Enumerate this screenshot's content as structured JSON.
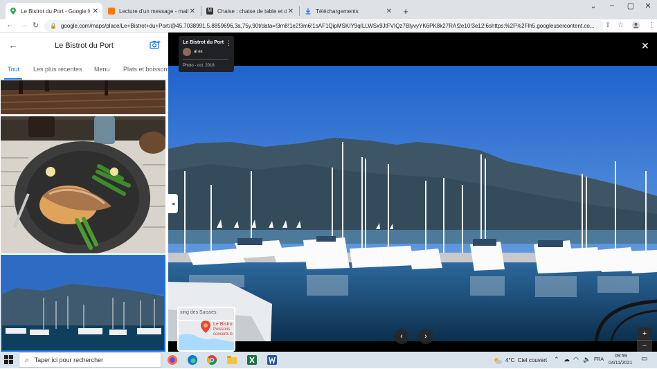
{
  "browser": {
    "tabs": [
      {
        "label": "Le Bistrot du Port - Google Maps",
        "active": true,
        "icon": "maps-pin-icon"
      },
      {
        "label": "Lecture d'un message - mail Orange",
        "active": false,
        "icon": "orange-mail-icon"
      },
      {
        "label": "Chaise : chaise de table et de salle",
        "active": false,
        "icon": "m-site-icon"
      },
      {
        "label": "Téléchargements",
        "active": false,
        "icon": "download-icon"
      }
    ],
    "new_tab": "+",
    "url": "google.com/maps/place/Le+Bistrot+du+Port/@45.7038991,5.8859696,3a,75y,90t/data=!3m8!1e2!3m6!1sAF1QipMSKIY9qILLWSx9JtFVIQz7BlyvyYK6PK8k27RA!2e10!3e12!6shttps:%2F%2Flh5.googleusercontent.co..."
  },
  "left_panel": {
    "title": "Le Bistrot du Port",
    "tabs": [
      "Tout",
      "Les plus récentes",
      "Menu",
      "Plats et boissons"
    ]
  },
  "viewer": {
    "info": {
      "place": "Le Bistrot du Port",
      "author": "al ex",
      "date": "Photo - oct. 2018"
    },
    "minimap": {
      "label1": "xing des Suisses",
      "label2": "Le Bistro",
      "label3": "Poissons",
      "label4": "concerts b"
    },
    "zoom_in": "+",
    "zoom_out": "−"
  },
  "taskbar": {
    "search_placeholder": "Taper ici pour rechercher",
    "weather": "4°C  Ciel couvert",
    "lang": "FRA",
    "time": "09:59",
    "date": "04/11/2021"
  }
}
